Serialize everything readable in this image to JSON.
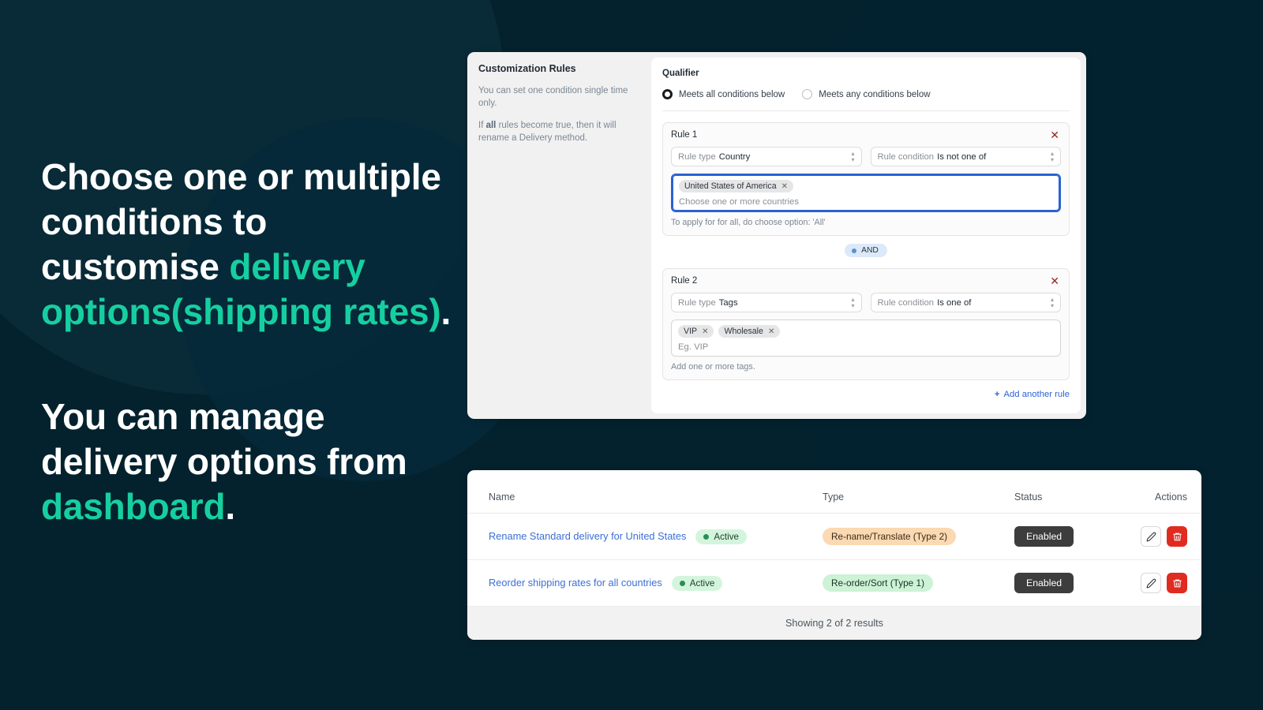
{
  "theme": {
    "background": "#04222e",
    "accent": "#16cfa0",
    "link": "#3b6fd4",
    "danger": "#e02b20"
  },
  "copy": {
    "heading1_part1": "Choose one or multiple conditions to customise ",
    "heading1_accent": "delivery options(shipping rates)",
    "heading1_end": ".",
    "heading2_part1": "You can manage delivery options from ",
    "heading2_accent": "dashboard",
    "heading2_end": "."
  },
  "rules_panel": {
    "title": "Customization Rules",
    "desc1": "You can set one condition single time only.",
    "desc2_pre": "If ",
    "desc2_bold": "all",
    "desc2_post": " rules become true, then it will rename a Delivery method.",
    "qualifier_title": "Qualifier",
    "qualifier_options": [
      {
        "label": "Meets all conditions below",
        "selected": true
      },
      {
        "label": "Meets any conditions below",
        "selected": false
      }
    ],
    "connector": {
      "label": "AND",
      "icon": "dot-icon"
    },
    "add_rule_label": "Add another rule",
    "add_rule_icon": "plus-icon",
    "close_icon": "close-icon",
    "caret_icon": "chevron-updown-icon",
    "rules": [
      {
        "title": "Rule 1",
        "type_label": "Rule type",
        "type_value": "Country",
        "condition_label": "Rule condition",
        "condition_value": "Is not one of",
        "tokens": [
          "United States of America"
        ],
        "token_placeholder": "Choose one or more countries",
        "help": "To apply for for all, do choose option: 'All'",
        "focused": true
      },
      {
        "title": "Rule 2",
        "type_label": "Rule type",
        "type_value": "Tags",
        "condition_label": "Rule condition",
        "condition_value": "Is one of",
        "tokens": [
          "VIP",
          "Wholesale"
        ],
        "token_placeholder": "Eg. VIP",
        "help": "Add one or more tags.",
        "focused": false
      }
    ]
  },
  "table": {
    "columns": [
      "Name",
      "Type",
      "Status",
      "Actions"
    ],
    "rows": [
      {
        "name": "Rename Standard delivery for United States",
        "state": "Active",
        "type": "Re-name/Translate (Type 2)",
        "type_color": "orange",
        "status": "Enabled",
        "edit_icon": "pencil-icon",
        "delete_icon": "trash-icon"
      },
      {
        "name": "Reorder shipping rates for all countries",
        "state": "Active",
        "type": "Re-order/Sort (Type 1)",
        "type_color": "green",
        "status": "Enabled",
        "edit_icon": "pencil-icon",
        "delete_icon": "trash-icon"
      }
    ],
    "footer": "Showing 2 of 2 results"
  }
}
